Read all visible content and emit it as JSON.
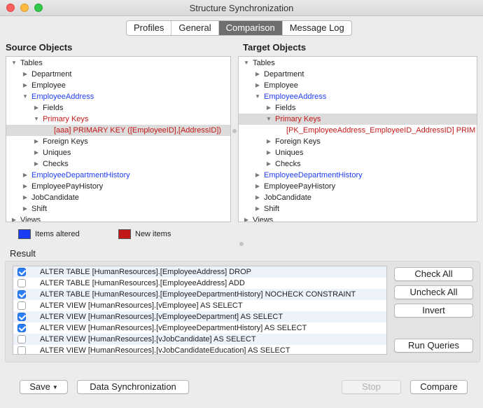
{
  "window": {
    "title": "Structure Synchronization"
  },
  "tabs": [
    {
      "label": "Profiles"
    },
    {
      "label": "General"
    },
    {
      "label": "Comparison"
    },
    {
      "label": "Message Log"
    }
  ],
  "source": {
    "heading": "Source Objects",
    "rows": [
      {
        "text": "Tables",
        "arrow": "▼"
      },
      {
        "text": "Department",
        "arrow": "▶"
      },
      {
        "text": "Employee",
        "arrow": "▶"
      },
      {
        "text": "EmployeeAddress",
        "arrow": "▼"
      },
      {
        "text": "Fields",
        "arrow": "▶"
      },
      {
        "text": "Primary Keys",
        "arrow": "▼"
      },
      {
        "text": "[aaa] PRIMARY KEY ([EmployeeID],[AddressID])",
        "arrow": ""
      },
      {
        "text": "Foreign Keys",
        "arrow": "▶"
      },
      {
        "text": "Uniques",
        "arrow": "▶"
      },
      {
        "text": "Checks",
        "arrow": "▶"
      },
      {
        "text": "EmployeeDepartmentHistory",
        "arrow": "▶"
      },
      {
        "text": "EmployeePayHistory",
        "arrow": "▶"
      },
      {
        "text": "JobCandidate",
        "arrow": "▶"
      },
      {
        "text": "Shift",
        "arrow": "▶"
      },
      {
        "text": "Views",
        "arrow": "▶"
      }
    ]
  },
  "target": {
    "heading": "Target Objects",
    "rows": [
      {
        "text": "Tables",
        "arrow": "▼"
      },
      {
        "text": "Department",
        "arrow": "▶"
      },
      {
        "text": "Employee",
        "arrow": "▶"
      },
      {
        "text": "EmployeeAddress",
        "arrow": "▼"
      },
      {
        "text": "Fields",
        "arrow": "▶"
      },
      {
        "text": "Primary Keys",
        "arrow": "▼"
      },
      {
        "text": "[PK_EmployeeAddress_EmployeeID_AddressID] PRIM",
        "arrow": ""
      },
      {
        "text": "Foreign Keys",
        "arrow": "▶"
      },
      {
        "text": "Uniques",
        "arrow": "▶"
      },
      {
        "text": "Checks",
        "arrow": "▶"
      },
      {
        "text": "EmployeeDepartmentHistory",
        "arrow": "▶"
      },
      {
        "text": "EmployeePayHistory",
        "arrow": "▶"
      },
      {
        "text": "JobCandidate",
        "arrow": "▶"
      },
      {
        "text": "Shift",
        "arrow": "▶"
      },
      {
        "text": "Views",
        "arrow": "▶"
      }
    ]
  },
  "legend": {
    "altered": {
      "label": "Items altered",
      "color": "#1a3cf5"
    },
    "new": {
      "label": "New items",
      "color": "#c01818"
    }
  },
  "result": {
    "heading": "Result",
    "items": [
      {
        "text": "ALTER TABLE [HumanResources].[EmployeeAddress] DROP",
        "checked": true
      },
      {
        "text": "ALTER TABLE [HumanResources].[EmployeeAddress] ADD",
        "checked": false
      },
      {
        "text": "ALTER TABLE [HumanResources].[EmployeeDepartmentHistory] NOCHECK CONSTRAINT",
        "checked": true
      },
      {
        "text": "ALTER VIEW [HumanResources].[vEmployee] AS SELECT",
        "checked": false
      },
      {
        "text": "ALTER VIEW [HumanResources].[vEmployeeDepartment] AS SELECT",
        "checked": true
      },
      {
        "text": "ALTER VIEW [HumanResources].[vEmployeeDepartmentHistory] AS SELECT",
        "checked": true
      },
      {
        "text": "ALTER VIEW [HumanResources].[vJobCandidate] AS SELECT",
        "checked": false
      },
      {
        "text": "ALTER VIEW [HumanResources].[vJobCandidateEducation] AS SELECT",
        "checked": false
      }
    ],
    "buttons": {
      "check_all": "Check All",
      "uncheck_all": "Uncheck All",
      "invert": "Invert",
      "run_queries": "Run Queries"
    }
  },
  "footer": {
    "save": "Save",
    "data_sync": "Data Synchronization",
    "stop": "Stop",
    "compare": "Compare"
  }
}
